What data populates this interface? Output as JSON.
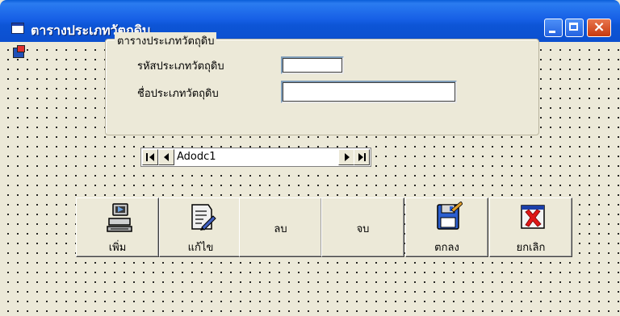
{
  "window": {
    "title": "ตารางประเภทวัตถุดิบ"
  },
  "form": {
    "frame_caption": "ตารางประเภทวัตถุดิบ",
    "code_label": "รหัสประเภทวัตถุดิบ",
    "code_value": "",
    "name_label": "ชื่อประเภทวัตถุดิบ",
    "name_value": ""
  },
  "data_control": {
    "caption": "Adodc1"
  },
  "buttons": [
    {
      "label": "เพิ่ม",
      "icon": "computer-icon"
    },
    {
      "label": "แก้ไข",
      "icon": "edit-document-icon"
    },
    {
      "label": "ลบ",
      "icon": ""
    },
    {
      "label": "จบ",
      "icon": ""
    },
    {
      "label": "ตกลง",
      "icon": "floppy-disk-icon"
    },
    {
      "label": "ยกเลิก",
      "icon": "red-x-icon"
    }
  ],
  "colors": {
    "titlebar": "#0b4fcf",
    "form_background": "#ece9d8",
    "close_button": "#c8390e"
  }
}
